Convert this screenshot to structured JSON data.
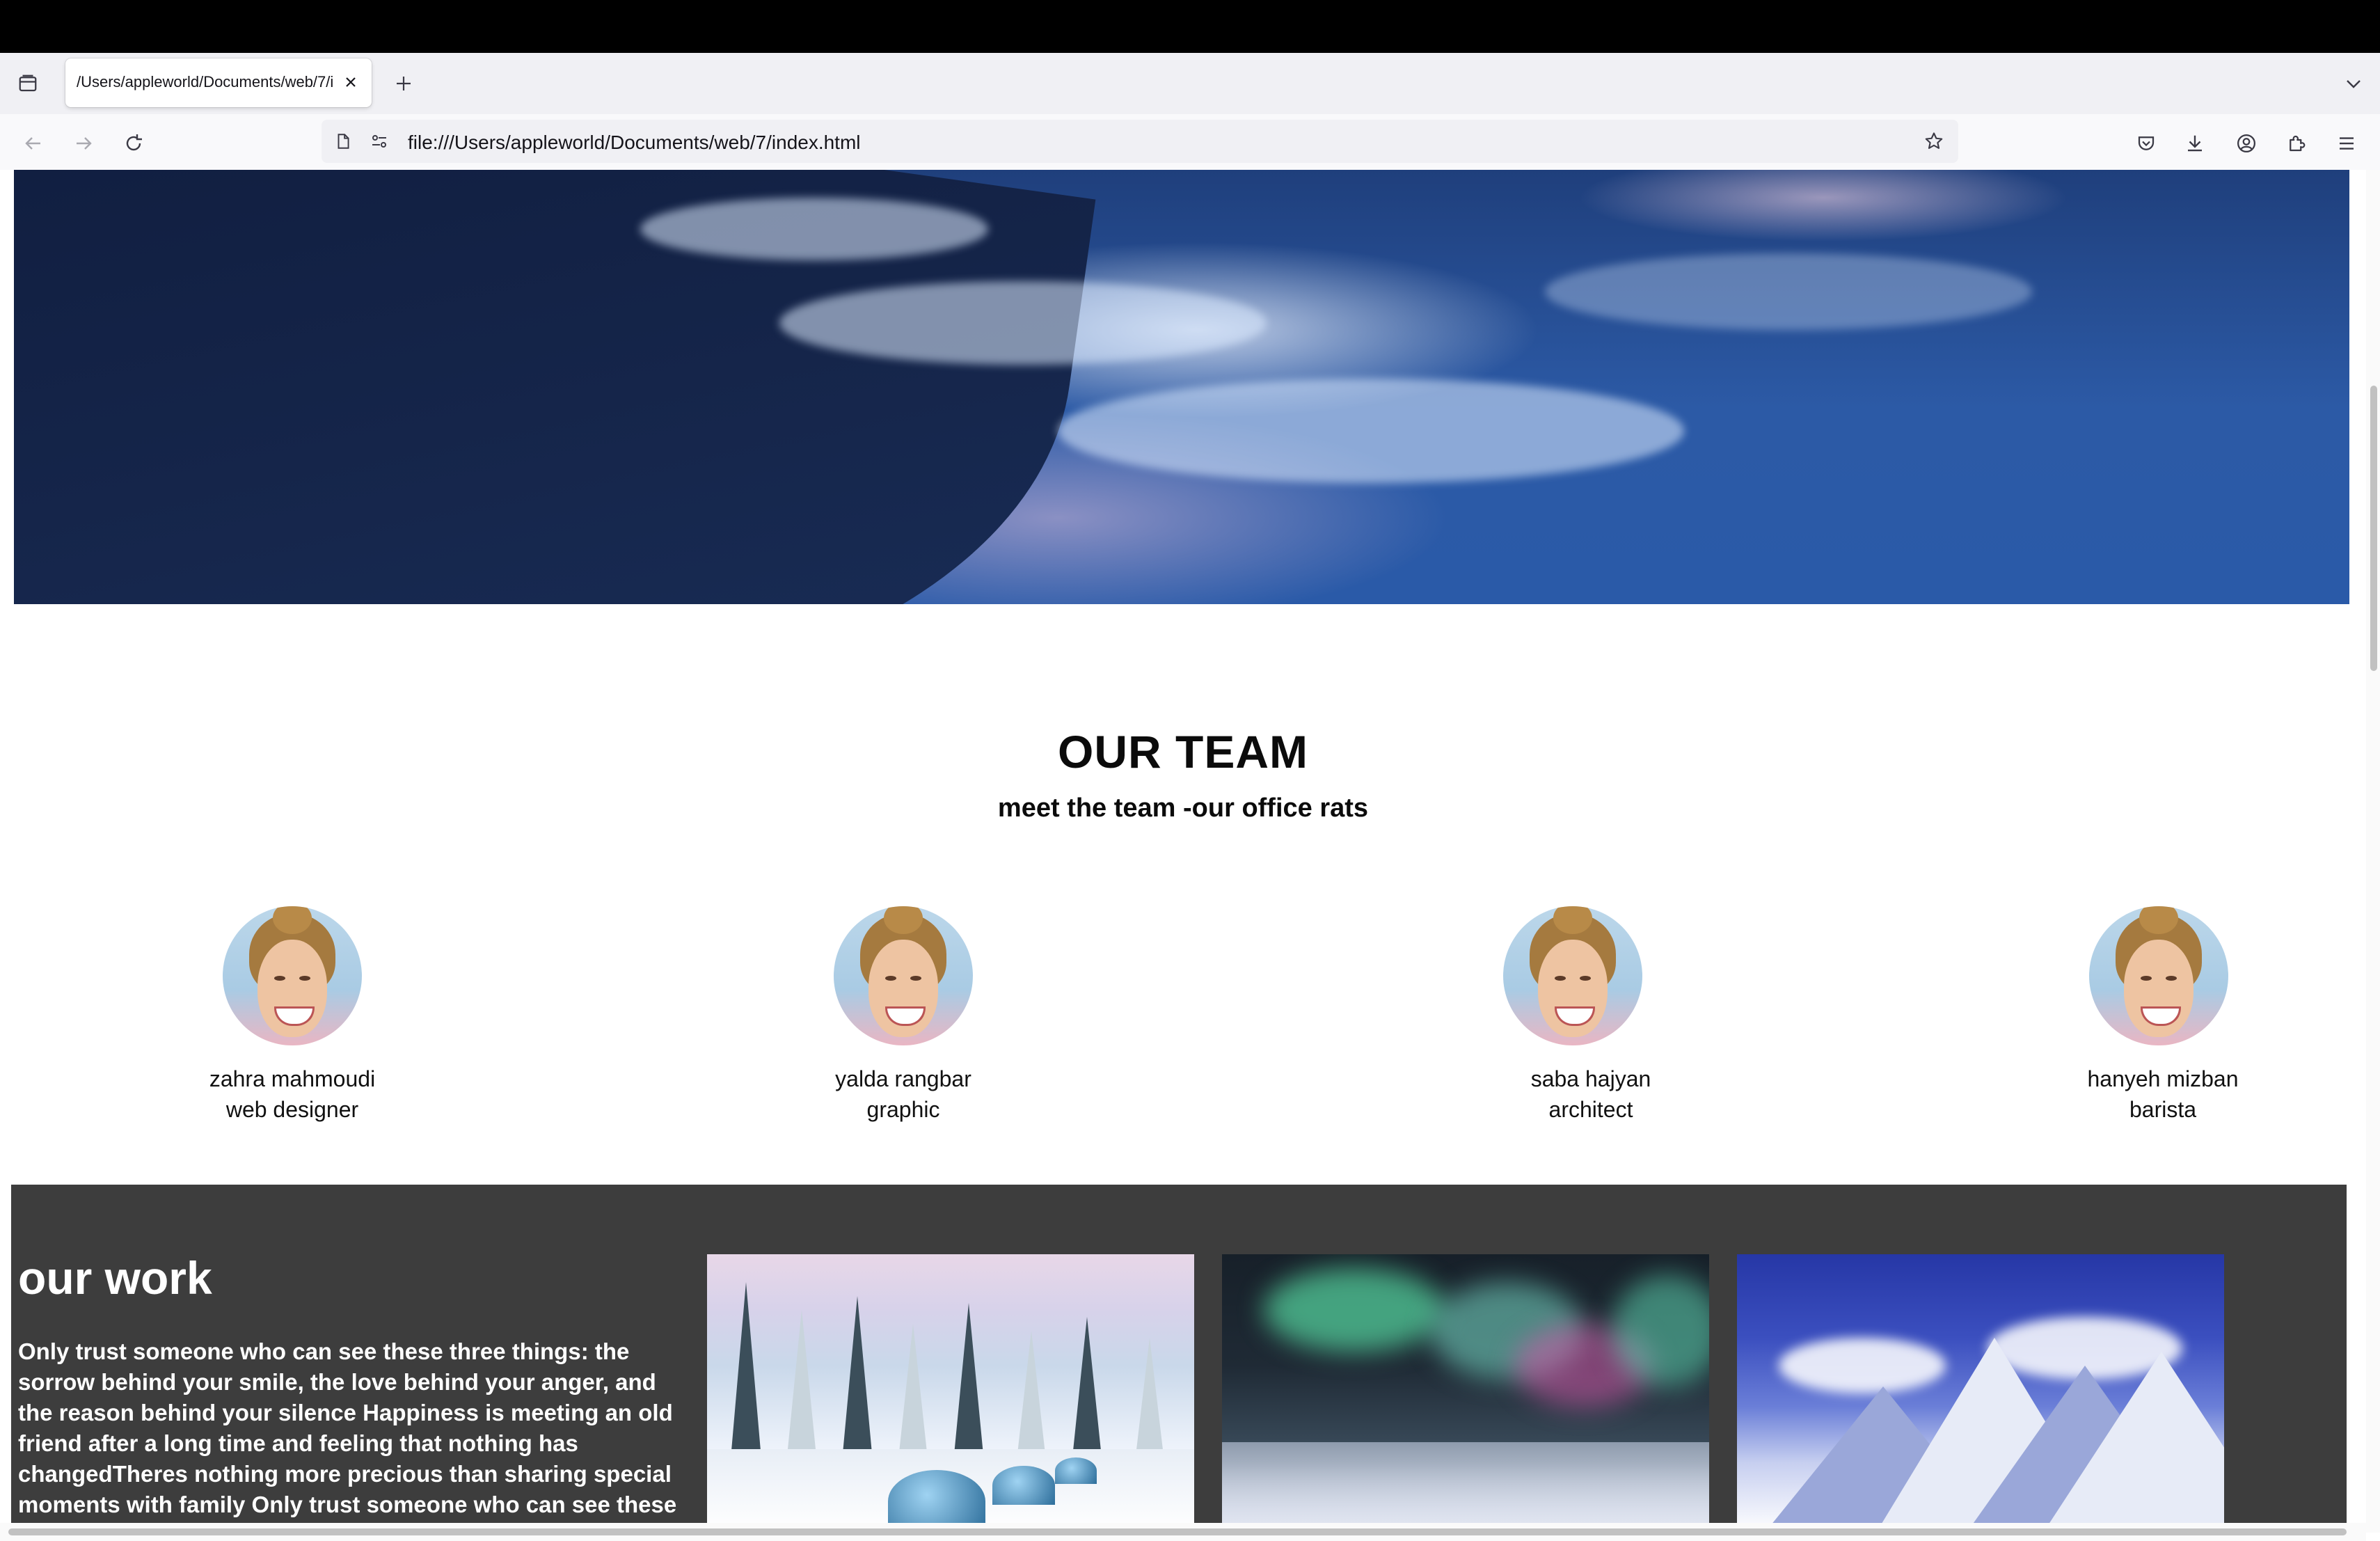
{
  "browser": {
    "tab_title": "/Users/appleworld/Documents/web/7/index.html",
    "url": "file:///Users/appleworld/Documents/web/7/index.html"
  },
  "team": {
    "heading": "OUR TEAM",
    "subheading": "meet the team -our office rats",
    "members": [
      {
        "name": "zahra mahmoudi",
        "role": "web designer"
      },
      {
        "name": "yalda rangbar",
        "role": "graphic"
      },
      {
        "name": "saba hajyan",
        "role": "architect"
      },
      {
        "name": "hanyeh mizban",
        "role": "barista"
      }
    ]
  },
  "work": {
    "title": "our work",
    "text": "Only trust someone who can see these three things: the sorrow behind your smile, the love behind your anger, and the reason behind your silence Happiness is meeting an old friend after a long time and feeling that nothing has changedTheres nothing more precious than sharing special moments with family Only trust someone who can see these"
  }
}
